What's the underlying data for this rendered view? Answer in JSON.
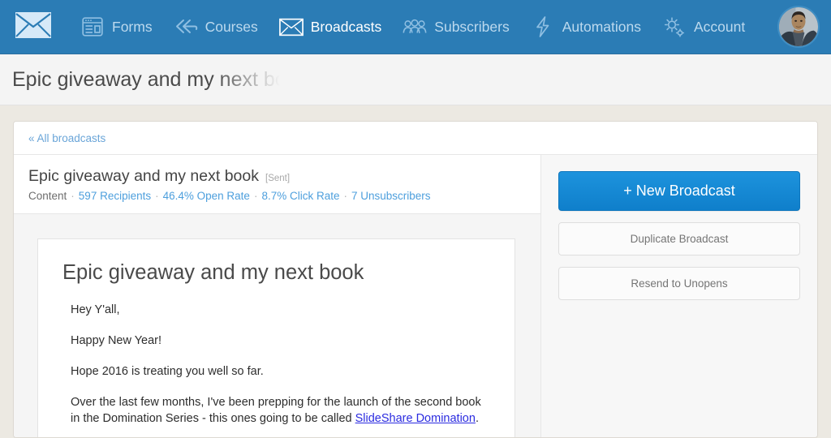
{
  "nav": {
    "logo_icon": "envelope-logo-icon",
    "items": [
      {
        "label": "Forms",
        "icon": "forms-icon",
        "active": false
      },
      {
        "label": "Courses",
        "icon": "rewind-arrows-icon",
        "active": false
      },
      {
        "label": "Broadcasts",
        "icon": "envelope-icon",
        "active": true
      },
      {
        "label": "Subscribers",
        "icon": "people-icon",
        "active": false
      },
      {
        "label": "Automations",
        "icon": "lightning-bolt-icon",
        "active": false
      },
      {
        "label": "Account",
        "icon": "gear-icon",
        "active": false
      }
    ],
    "avatar_alt": "user-avatar"
  },
  "titlebar": {
    "title": "Epic giveaway and my next book"
  },
  "card": {
    "back_link": "« All broadcasts"
  },
  "broadcast": {
    "title": "Epic giveaway and my next book",
    "status": "[Sent]",
    "stats": [
      {
        "label": "Content",
        "link": false
      },
      {
        "label": "597 Recipients",
        "link": true
      },
      {
        "label": "46.4% Open Rate",
        "link": true
      },
      {
        "label": "8.7% Click Rate",
        "link": true
      },
      {
        "label": "7 Unsubscribers",
        "link": true
      }
    ],
    "separator": "·"
  },
  "email": {
    "heading": "Epic giveaway and my next book",
    "paragraphs": [
      {
        "text": "Hey Y'all,"
      },
      {
        "text": "Happy New Year!"
      },
      {
        "text": "Hope 2016 is treating you well so far."
      },
      {
        "before": "Over the last few months, I've been prepping for the launch of the second book in the Domination Series - this ones going to be called ",
        "link": "SlideShare Domination",
        "after": "."
      }
    ]
  },
  "sidebar": {
    "new_broadcast": "+ New Broadcast",
    "duplicate_broadcast": "Duplicate Broadcast",
    "resend_unopens": "Resend to Unopens"
  },
  "colors": {
    "nav_blue": "#2b7cb5",
    "primary_blue": "#0f7fcb",
    "link_blue": "#4d9fdd",
    "page_bg": "#ece9e2",
    "email_link": "#2b2be0"
  }
}
